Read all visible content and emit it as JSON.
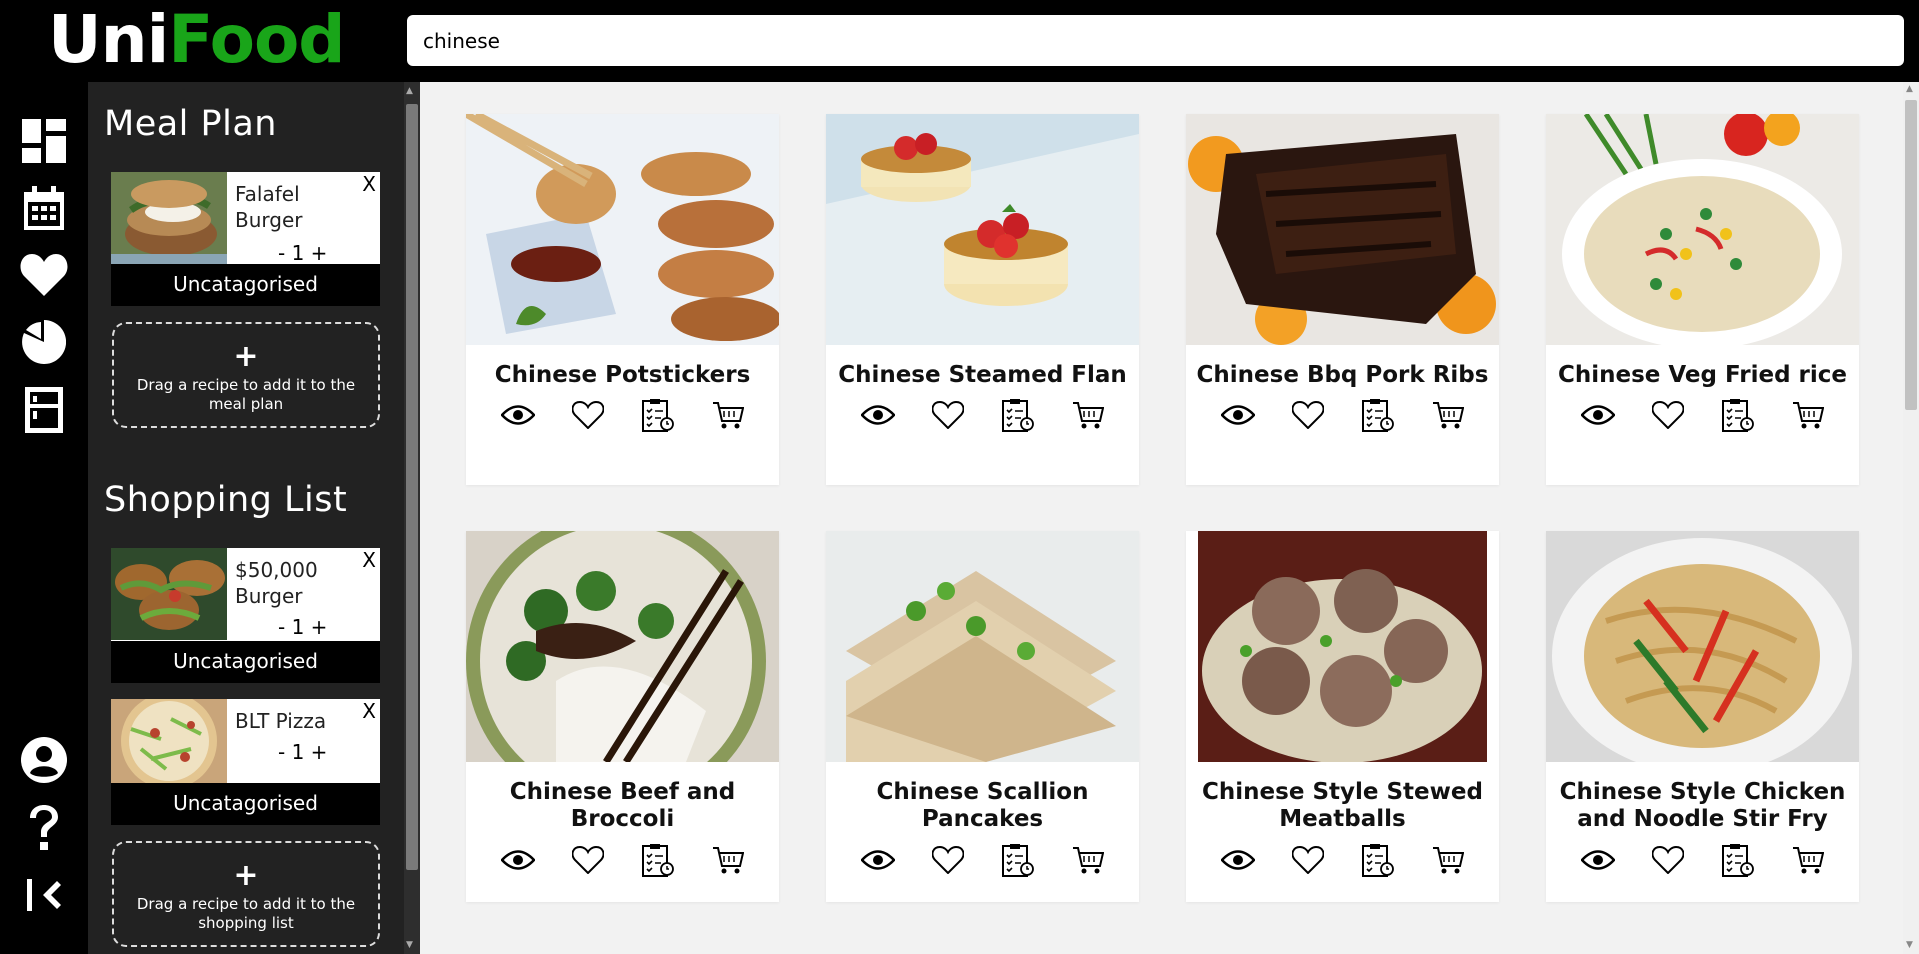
{
  "app": {
    "logo_part1": "Uni",
    "logo_part2": "Food",
    "brand_color": "#19a519"
  },
  "search": {
    "value": "chinese",
    "placeholder": ""
  },
  "rail": {
    "top_icons": [
      "dashboard-icon",
      "calendar-icon",
      "heart-icon",
      "pie-chart-icon",
      "fridge-icon"
    ],
    "bottom_icons": [
      "user-icon",
      "help-icon",
      "collapse-icon"
    ]
  },
  "meal_plan": {
    "title": "Meal Plan",
    "items": [
      {
        "name": "Falafel Burger",
        "quantity": "- 1 +",
        "category": "Uncatagorised",
        "remove": "X"
      }
    ],
    "drop_plus": "+",
    "drop_text": "Drag a recipe to add it to the meal plan"
  },
  "shopping_list": {
    "title": "Shopping List",
    "items": [
      {
        "name": "$50,000 Burger",
        "quantity": "- 1 +",
        "category": "Uncatagorised",
        "remove": "X"
      },
      {
        "name": "BLT Pizza",
        "quantity": "- 1 +",
        "category": "Uncatagorised",
        "remove": "X"
      }
    ],
    "drop_plus": "+",
    "drop_text": "Drag a recipe to add it to the shopping list"
  },
  "recipes": [
    {
      "title": "Chinese Potstickers"
    },
    {
      "title": "Chinese Steamed Flan"
    },
    {
      "title": "Chinese Bbq Pork Ribs"
    },
    {
      "title": "Chinese Veg Fried rice"
    },
    {
      "title": "Chinese Beef and Broccoli"
    },
    {
      "title": "Chinese Scallion Pancakes"
    },
    {
      "title": "Chinese Style Stewed Meatballs"
    },
    {
      "title": "Chinese Style Chicken and Noodle Stir Fry"
    }
  ],
  "card_actions": [
    "view-icon",
    "favorite-icon",
    "add-to-meal-plan-icon",
    "add-to-cart-icon"
  ]
}
